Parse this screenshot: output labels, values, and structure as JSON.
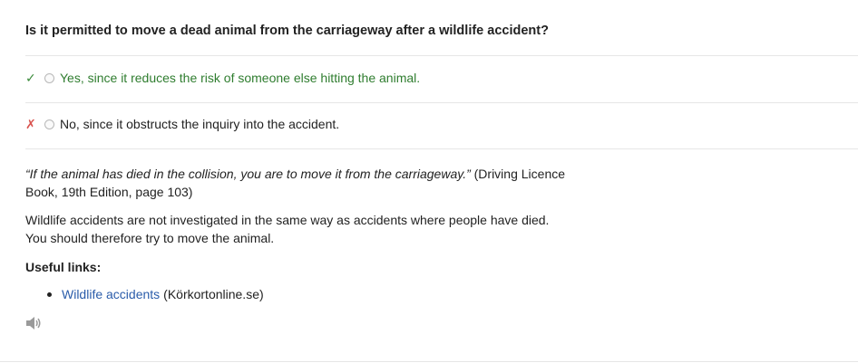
{
  "question": {
    "text": "Is it permitted to move a dead animal from the carriageway after a wildlife accident?"
  },
  "answers": [
    {
      "mark": "✓",
      "status": "correct",
      "text": "Yes, since it reduces the risk of someone else hitting the animal.",
      "selected": false
    },
    {
      "mark": "✗",
      "status": "wrong",
      "text": "No, since it obstructs the inquiry into the accident.",
      "selected": false
    }
  ],
  "explanation": {
    "quote": "“If the animal has died in the collision, you are to move it from the carriageway.”",
    "source": " (Driving Licence Book, 19th Edition, page 103)",
    "paragraph": "Wildlife accidents are not investigated in the same way as accidents where people have died. You should therefore try to move the animal."
  },
  "useful_links": {
    "title": "Useful links:",
    "items": [
      {
        "label": "Wildlife accidents",
        "source": "(Körkortonline.se)"
      }
    ]
  },
  "audio": {
    "icon": "speaker-icon"
  },
  "colors": {
    "correct": "#2f7d2f",
    "wrong": "#d9534f",
    "link": "#2a5caa"
  }
}
